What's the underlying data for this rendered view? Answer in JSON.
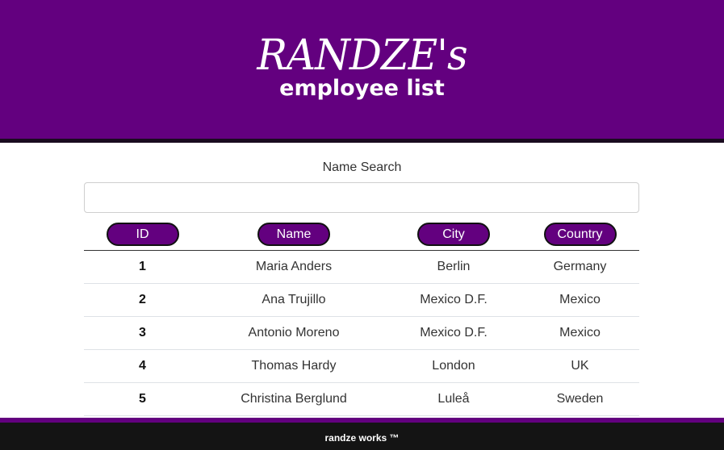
{
  "header": {
    "logo_script": "RANDZE's",
    "logo_sub": "employee list",
    "background": "#63007f"
  },
  "search": {
    "label": "Name Search",
    "value": "",
    "placeholder": ""
  },
  "table": {
    "columns": [
      "ID",
      "Name",
      "City",
      "Country"
    ],
    "rows": [
      {
        "id": "1",
        "name": "Maria Anders",
        "city": "Berlin",
        "country": "Germany"
      },
      {
        "id": "2",
        "name": "Ana Trujillo",
        "city": "Mexico D.F.",
        "country": "Mexico"
      },
      {
        "id": "3",
        "name": "Antonio Moreno",
        "city": "Mexico D.F.",
        "country": "Mexico"
      },
      {
        "id": "4",
        "name": "Thomas Hardy",
        "city": "London",
        "country": "UK"
      },
      {
        "id": "5",
        "name": "Christina Berglund",
        "city": "Luleå",
        "country": "Sweden"
      }
    ]
  },
  "footer": {
    "text": "randze works ™"
  },
  "colors": {
    "accent": "#63007f",
    "footer_bg": "#141414"
  }
}
